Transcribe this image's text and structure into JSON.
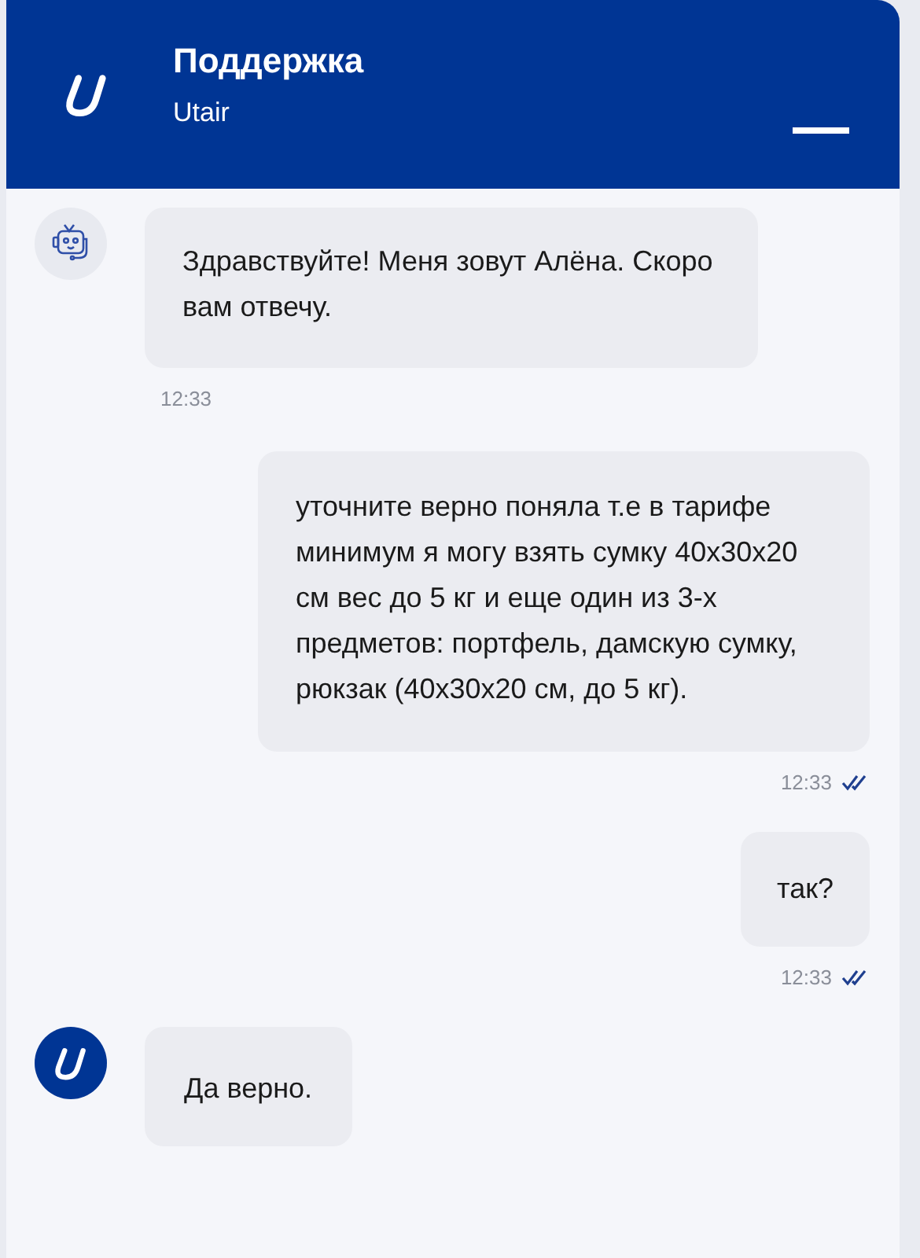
{
  "header": {
    "title": "Поддержка",
    "subtitle": "Utair"
  },
  "messages": [
    {
      "kind": "bot",
      "text": "Здравствуйте! Меня зовут Алёна. Скоро вам отвечу.",
      "time": "12:33"
    },
    {
      "kind": "user",
      "text": "уточните верно поняла т.е в тарифе минимум я могу взять сумку 40х30х20 см вес до 5 кг и еще один из 3-х предметов: портфель, дамскую сумку, рюкзак (40х30х20 см, до 5 кг).",
      "time": "12:33",
      "read": true
    },
    {
      "kind": "user",
      "text": "так?",
      "time": "12:33",
      "read": true
    },
    {
      "kind": "operator",
      "text": "Да верно."
    }
  ]
}
